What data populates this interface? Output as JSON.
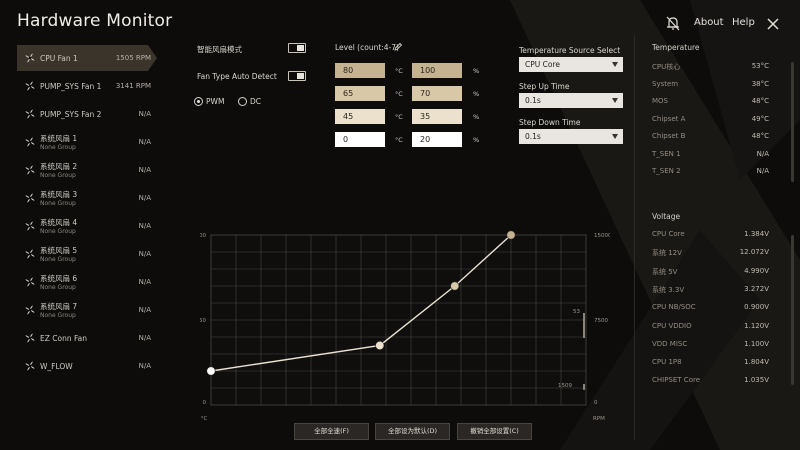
{
  "header": {
    "title": "Hardware Monitor",
    "about_label": "About",
    "help_label": "Help"
  },
  "fans": [
    {
      "name": "CPU Fan 1",
      "sub": "",
      "value": "1505 RPM",
      "active": true
    },
    {
      "name": "PUMP_SYS Fan 1",
      "sub": "",
      "value": "3141 RPM",
      "active": false
    },
    {
      "name": "PUMP_SYS Fan 2",
      "sub": "",
      "value": "N/A",
      "active": false
    },
    {
      "name": "系统风扇 1",
      "sub": "None Group",
      "value": "N/A",
      "active": false
    },
    {
      "name": "系统风扇 2",
      "sub": "None Group",
      "value": "N/A",
      "active": false
    },
    {
      "name": "系统风扇 3",
      "sub": "None Group",
      "value": "N/A",
      "active": false
    },
    {
      "name": "系统风扇 4",
      "sub": "None Group",
      "value": "N/A",
      "active": false
    },
    {
      "name": "系统风扇 5",
      "sub": "None Group",
      "value": "N/A",
      "active": false
    },
    {
      "name": "系统风扇 6",
      "sub": "None Group",
      "value": "N/A",
      "active": false
    },
    {
      "name": "系统风扇 7",
      "sub": "None Group",
      "value": "N/A",
      "active": false
    },
    {
      "name": "EZ Conn Fan",
      "sub": "",
      "value": "N/A",
      "active": false
    },
    {
      "name": "W_FLOW",
      "sub": "",
      "value": "N/A",
      "active": false
    }
  ],
  "controls": {
    "smart_mode_label": "智能风扇模式",
    "smart_mode_on": true,
    "auto_detect_label": "Fan Type Auto Detect",
    "auto_detect_on": true,
    "pwm_label": "PWM",
    "dc_label": "DC",
    "selected_mode": "PWM"
  },
  "levels": {
    "title": "Level (count:4-7)",
    "temp_unit": "°C",
    "speed_unit": "%",
    "rows": [
      {
        "temp": "80",
        "speed": "100",
        "color": "#c4b291"
      },
      {
        "temp": "65",
        "speed": "70",
        "color": "#d8c8a8"
      },
      {
        "temp": "45",
        "speed": "35",
        "color": "#ece1cc"
      },
      {
        "temp": "0",
        "speed": "20",
        "color": "#ffffff"
      }
    ]
  },
  "source": {
    "temp_source_label": "Temperature Source Select",
    "temp_source_value": "CPU Core",
    "step_up_label": "Step Up Time",
    "step_up_value": "0.1s",
    "step_down_label": "Step Down Time",
    "step_down_value": "0.1s"
  },
  "temperature": {
    "title": "Temperature",
    "items": [
      {
        "name": "CPU核心",
        "value": "53°C"
      },
      {
        "name": "System",
        "value": "38°C"
      },
      {
        "name": "MOS",
        "value": "48°C"
      },
      {
        "name": "Chipset A",
        "value": "49°C"
      },
      {
        "name": "Chipset B",
        "value": "48°C"
      },
      {
        "name": "T_SEN 1",
        "value": "N/A"
      },
      {
        "name": "T_SEN 2",
        "value": "N/A"
      }
    ]
  },
  "voltage": {
    "title": "Voltage",
    "items": [
      {
        "name": "CPU Core",
        "value": "1.384V"
      },
      {
        "name": "系统 12V",
        "value": "12.072V"
      },
      {
        "name": "系统 5V",
        "value": "4.990V"
      },
      {
        "name": "系统 3.3V",
        "value": "3.272V"
      },
      {
        "name": "CPU NB/SOC",
        "value": "0.900V"
      },
      {
        "name": "CPU VDDIO",
        "value": "1.120V"
      },
      {
        "name": "VDD MISC",
        "value": "1.100V"
      },
      {
        "name": "CPU 1P8",
        "value": "1.804V"
      },
      {
        "name": "CHIPSET Core",
        "value": "1.035V"
      }
    ]
  },
  "chart_data": {
    "type": "line",
    "x": [
      0,
      45,
      65,
      80
    ],
    "y": [
      20,
      35,
      70,
      100
    ],
    "xlim": [
      0,
      100
    ],
    "ylim": [
      0,
      100
    ],
    "left_ticks": [
      "100",
      "50",
      "0"
    ],
    "right_ticks": [
      "15000",
      "7500",
      "0"
    ],
    "xlabel": "°C",
    "right_axis_label": "RPM",
    "current_temp_label": "53",
    "current_temp": 53,
    "current_rpm_label": "1509",
    "current_rpm": 1509,
    "colors": {
      "line": "#e9e1d2",
      "points": [
        "#ffffff",
        "#ece1cc",
        "#d8c8a8",
        "#c4b291"
      ]
    }
  },
  "buttons": {
    "full_speed": "全部全速(F)",
    "set_default": "全部设为默认(D)",
    "cancel_all": "撤销全部设置(C)"
  }
}
